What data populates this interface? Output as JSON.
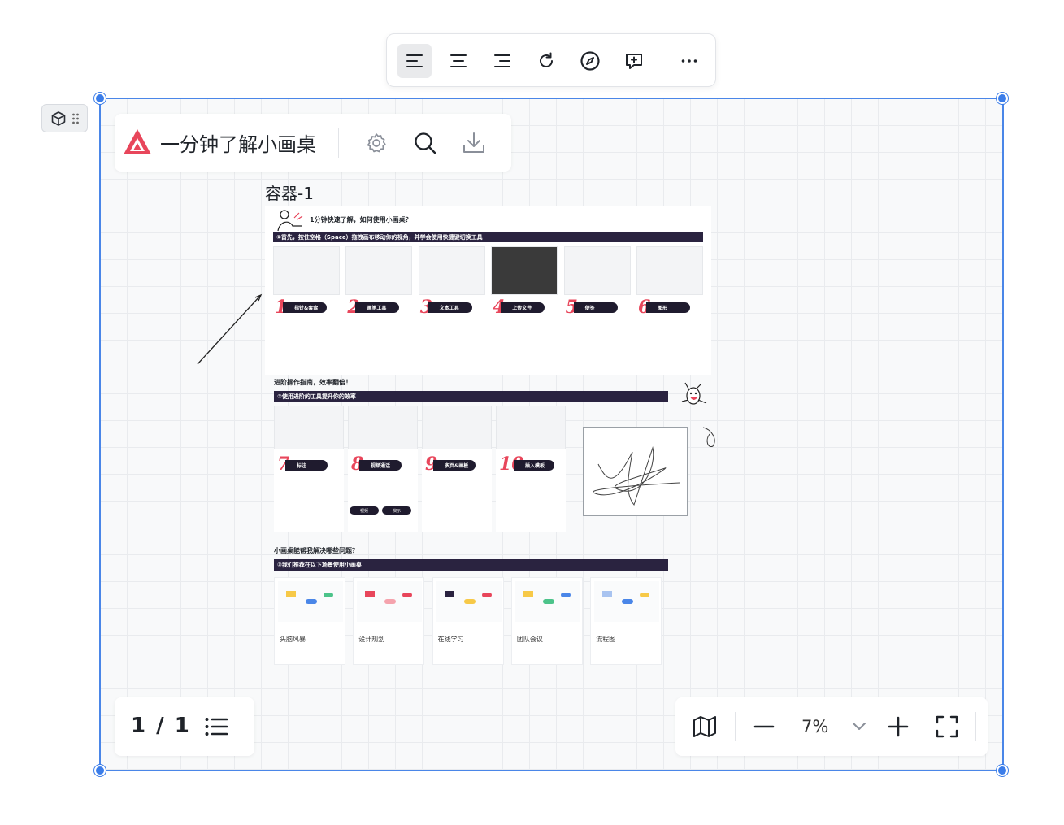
{
  "app": {
    "title": "一分钟了解小画桌"
  },
  "container": {
    "label": "容器-1"
  },
  "document": {
    "title": "1分钟快速了解，如何使用小画桌？",
    "section1_banner": "①首先，按住空格（Space）拖拽画布移动你的视角，并学会使用快捷键切换工具",
    "tools": [
      {
        "num": "1",
        "label": "指针&套索"
      },
      {
        "num": "2",
        "label": "画笔工具"
      },
      {
        "num": "3",
        "label": "文本工具"
      },
      {
        "num": "4",
        "label": "上传文件"
      },
      {
        "num": "5",
        "label": "便签"
      },
      {
        "num": "6",
        "label": "图形"
      }
    ],
    "section2_title": "进阶操作指南，效率翻倍！",
    "section2_banner": "②使用进阶的工具提升你的效率",
    "advanced": [
      {
        "num": "7",
        "label": "标注"
      },
      {
        "num": "8",
        "label": "视频通话"
      },
      {
        "num": "9",
        "label": "多页&画板"
      },
      {
        "num": "10",
        "label": "插入模板"
      }
    ],
    "video_buttons": [
      "视频",
      "演示"
    ],
    "section3_title": "小画桌能帮我解决哪些问题？",
    "section3_banner": "③我们推荐在以下场景使用小画桌",
    "scenes": [
      {
        "name": "头脑风暴"
      },
      {
        "name": "设计规划"
      },
      {
        "name": "在线学习"
      },
      {
        "name": "团队会议"
      },
      {
        "name": "流程图"
      }
    ]
  },
  "pagination": {
    "indicator": "1 / 1"
  },
  "zoom": {
    "value": "7%"
  },
  "icons": {
    "toolbar": [
      "align-left-icon",
      "align-center-icon",
      "align-right-icon",
      "refresh-icon",
      "compass-icon",
      "comment-add-icon",
      "more-icon"
    ],
    "header": [
      "logo-icon",
      "settings-icon",
      "search-icon",
      "download-icon"
    ],
    "bottom": [
      "list-icon",
      "map-icon",
      "zoom-out-icon",
      "chevron-down-icon",
      "zoom-in-icon",
      "fullscreen-icon"
    ]
  },
  "colors": {
    "selection": "#4a86e8",
    "banner": "#2a2340",
    "accent_number": "#e8465b",
    "logo": "#e8465b"
  }
}
